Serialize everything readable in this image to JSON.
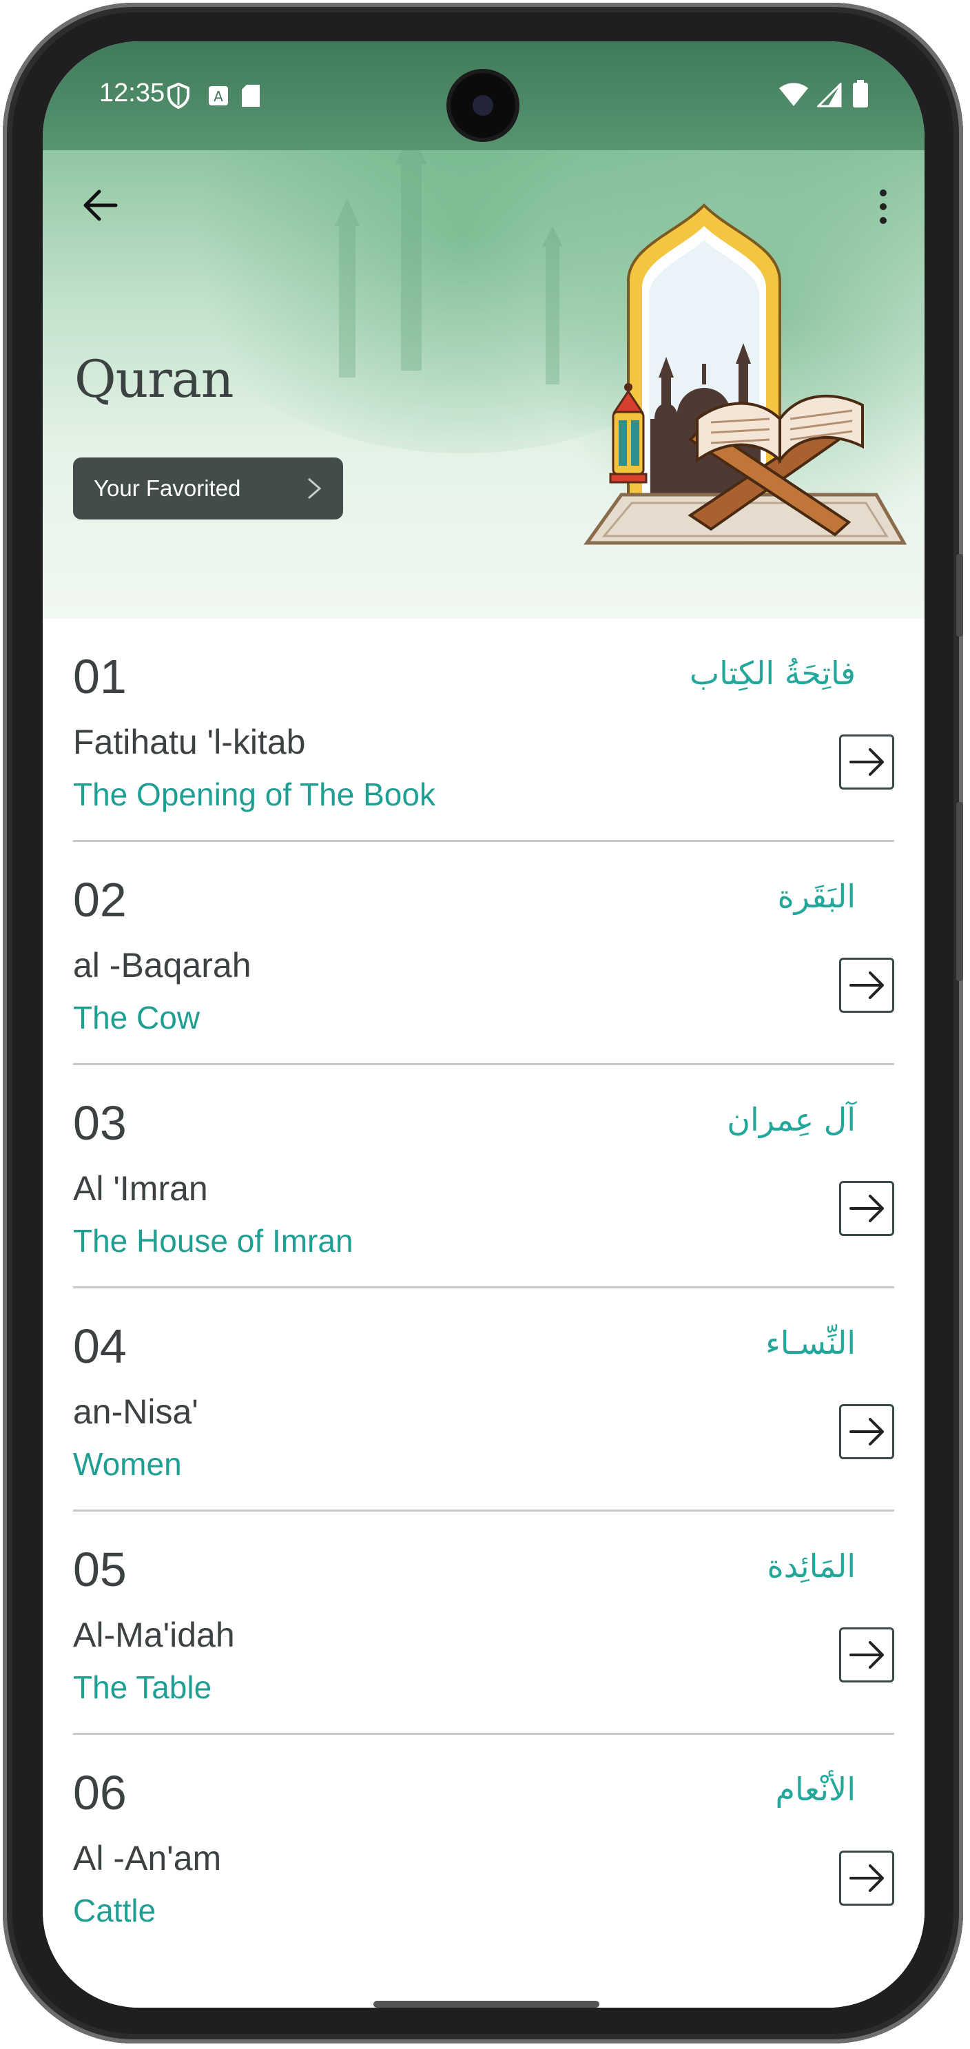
{
  "status_bar": {
    "time": "12:35",
    "left_icons": [
      "shield-icon",
      "accessibility-a-icon",
      "sd-card-icon"
    ],
    "right_icons": [
      "wifi-icon",
      "cell-signal-icon",
      "battery-icon"
    ]
  },
  "header": {
    "title": "Quran",
    "favorites_label": "Your Favorited"
  },
  "surahs": [
    {
      "number": "01",
      "arabic": "فاتِحَةُ الكِتاب",
      "latin": "Fatihatu 'l-kitab",
      "english": "The Opening of The Book"
    },
    {
      "number": "02",
      "arabic": "البَقَرة",
      "latin": "al -Baqarah",
      "english": "The Cow"
    },
    {
      "number": "03",
      "arabic": "آل عِمران",
      "latin": "Al 'Imran",
      "english": "The House of Imran"
    },
    {
      "number": "04",
      "arabic": "النِّسـاء",
      "latin": "an-Nisa'",
      "english": "Women"
    },
    {
      "number": "05",
      "arabic": "المَائِدة",
      "latin": "Al-Ma'idah",
      "english": "The Table"
    },
    {
      "number": "06",
      "arabic": "الأنْعام",
      "latin": "Al -An'am",
      "english": "Cattle"
    }
  ],
  "colors": {
    "accent_teal": "#22a79a",
    "dark_text": "#3c4243",
    "button_dark": "#414c4b",
    "header_green": "#8fc6a2"
  }
}
